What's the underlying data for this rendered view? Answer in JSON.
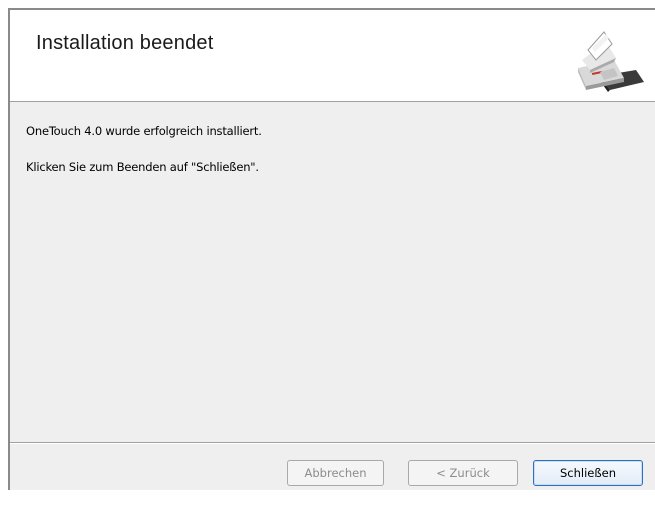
{
  "header": {
    "title": "Installation beendet",
    "icon": "scanner-icon"
  },
  "content": {
    "line1": "OneTouch 4.0 wurde erfolgreich installiert.",
    "line2": "Klicken Sie zum Beenden auf \"Schließen\"."
  },
  "footer": {
    "cancel_label": "Abbrechen",
    "back_label": "< Zurück",
    "close_label": "Schließen"
  },
  "colors": {
    "header_bg": "#ffffff",
    "body_bg": "#efefef",
    "default_button_border": "#2f6fbf",
    "disabled_text": "#8c8c8c"
  }
}
